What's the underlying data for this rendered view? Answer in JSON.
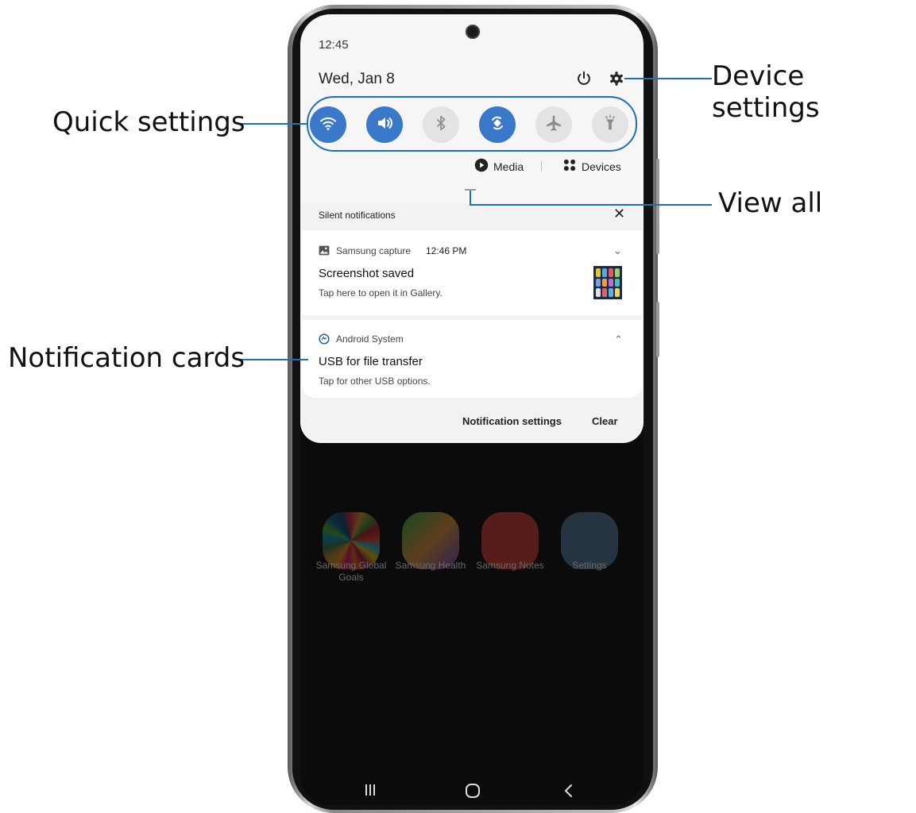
{
  "status": {
    "time": "12:45",
    "date": "Wed, Jan 8"
  },
  "quick_settings": [
    {
      "icon": "wifi-icon",
      "state": "on"
    },
    {
      "icon": "sound-icon",
      "state": "on"
    },
    {
      "icon": "bluetooth-icon",
      "state": "off"
    },
    {
      "icon": "auto-rotate-icon",
      "state": "on"
    },
    {
      "icon": "airplane-mode-icon",
      "state": "off"
    },
    {
      "icon": "flashlight-icon",
      "state": "off"
    }
  ],
  "media_row": {
    "media_label": "Media",
    "devices_label": "Devices"
  },
  "notifications": {
    "header": "Silent notifications",
    "cards": [
      {
        "app": "Samsung capture",
        "time": "12:46 PM",
        "title": "Screenshot saved",
        "text": "Tap here to open it in Gallery."
      },
      {
        "app": "Android System",
        "title": "USB for file transfer",
        "text": "Tap for other USB options."
      }
    ],
    "footer": {
      "settings_label": "Notification settings",
      "clear_label": "Clear"
    }
  },
  "home_apps": [
    {
      "label": "Samsung Global Goals"
    },
    {
      "label": "Samsung Health"
    },
    {
      "label": "Samsung Notes"
    },
    {
      "label": "Settings"
    }
  ],
  "callouts": {
    "device_settings": "Device settings",
    "quick_settings": "Quick settings",
    "view_all": "View all",
    "notification_cards": "Notification cards"
  },
  "colors": {
    "accent": "#1f6fb5",
    "tile_on": "#3a78c9",
    "tile_off": "#e3e3e3"
  }
}
